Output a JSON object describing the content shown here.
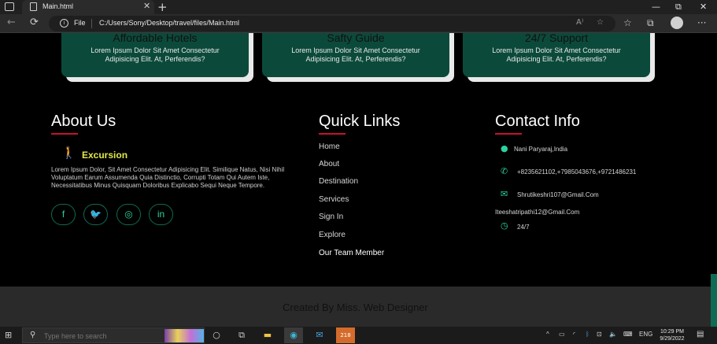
{
  "browser": {
    "tab_title": "Main.html",
    "tab_close": "✕",
    "new_tab": "+",
    "window_controls": {
      "minimize": "—",
      "restore": "⧉",
      "close": "✕"
    },
    "nav": {
      "back": "←",
      "refresh": "⟳"
    },
    "address": {
      "scheme": "File",
      "url": "C:/Users/Sony/Desktop/travel/files/Main.html",
      "read_aloud": "A⁾",
      "add_favorite": "☆"
    },
    "toolbar_icons": {
      "favorites": "☆",
      "collections": "⧉",
      "more": "···"
    }
  },
  "cards": [
    {
      "title": "Affordable Hotels",
      "text": "Lorem Ipsum Dolor Sit Amet Consectetur Adipisicing Elit. At, Perferendis?"
    },
    {
      "title": "Safty Guide",
      "text": "Lorem Ipsum Dolor Sit Amet Consectetur Adipisicing Elit. At, Perferendis?"
    },
    {
      "title": "24/7 Support",
      "text": "Lorem Ipsum Dolor Sit Amet Consectetur Adipisicing Elit. At, Perferendis?"
    }
  ],
  "about": {
    "title": "About Us",
    "brand": "Excursion",
    "text": "Lorem Ipsum Dolor, Sit Amet Consectetur Adipisicing Elit. Similique Natus, Nisi Nihil Voluptatum Earum Assumenda Quia Distinctio, Corrupti Totam Qui Autem Iste, Necessitatibus Minus Quisquam Doloribus Explicabo Sequi Neque Tempore.",
    "social": [
      {
        "name": "facebook",
        "glyph": "f"
      },
      {
        "name": "twitter",
        "glyph": "🐦"
      },
      {
        "name": "instagram",
        "glyph": "◎"
      },
      {
        "name": "linkedin",
        "glyph": "in"
      }
    ]
  },
  "quick_links": {
    "title": "Quick Links",
    "items": [
      "Home",
      "About",
      "Destination",
      "Services",
      "Sign In",
      "Explore",
      "Our Team Member"
    ]
  },
  "contact": {
    "title": "Contact Info",
    "address": "Nani Paryaraj,India",
    "phone": "+8235621102,+7985043676,+9721486231",
    "email1": "Shrutikeshri107@Gmail.Com",
    "email2": "Iteeshatripathi12@Gmail.Com",
    "hours": "24/7"
  },
  "footer": {
    "credit": "Created By Miss. Web Designer"
  },
  "taskbar": {
    "search_placeholder": "Type here to search",
    "tray_lang": "ENG",
    "badge": "218",
    "time": "10:29 PM",
    "date": "9/29/2022"
  }
}
